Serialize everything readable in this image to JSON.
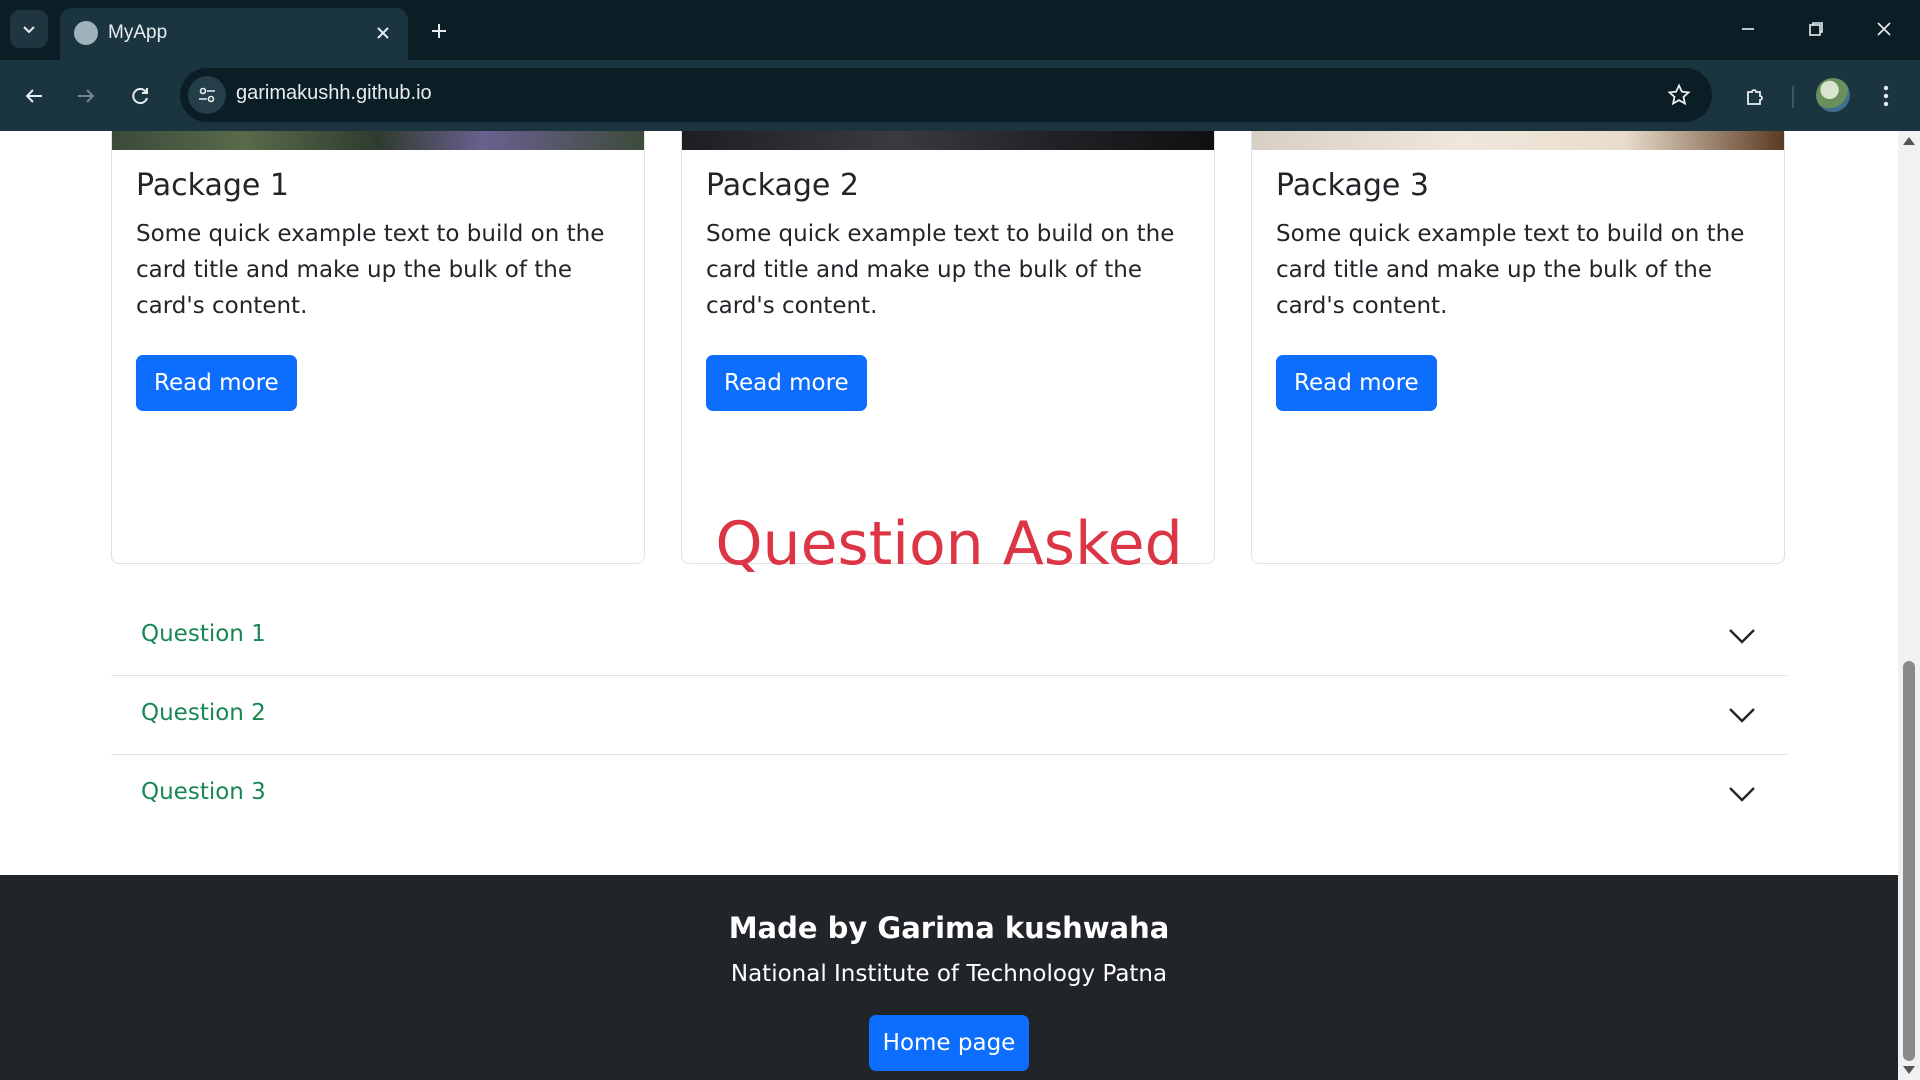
{
  "browser": {
    "tab_title": "MyApp",
    "url": "garimakushh.github.io"
  },
  "cards": [
    {
      "title": "Package 1",
      "text": "Some quick example text to build on the card title and make up the bulk of the card's content.",
      "button": "Read more"
    },
    {
      "title": "Package 2",
      "text": "Some quick example text to build on the card title and make up the bulk of the card's content.",
      "button": "Read more"
    },
    {
      "title": "Package 3",
      "text": "Some quick example text to build on the card title and make up the bulk of the card's content.",
      "button": "Read more"
    }
  ],
  "faq": {
    "heading": "Question Asked",
    "items": [
      {
        "label": "Question 1"
      },
      {
        "label": "Question 2"
      },
      {
        "label": "Question 3"
      }
    ]
  },
  "footer": {
    "title": "Made by Garima kushwaha",
    "subtitle": "National Institute of Technology Patna",
    "button": "Home page"
  },
  "colors": {
    "primary": "#0d6efd",
    "heading": "#dc3545",
    "question": "#198754",
    "footer_bg": "#212529"
  }
}
